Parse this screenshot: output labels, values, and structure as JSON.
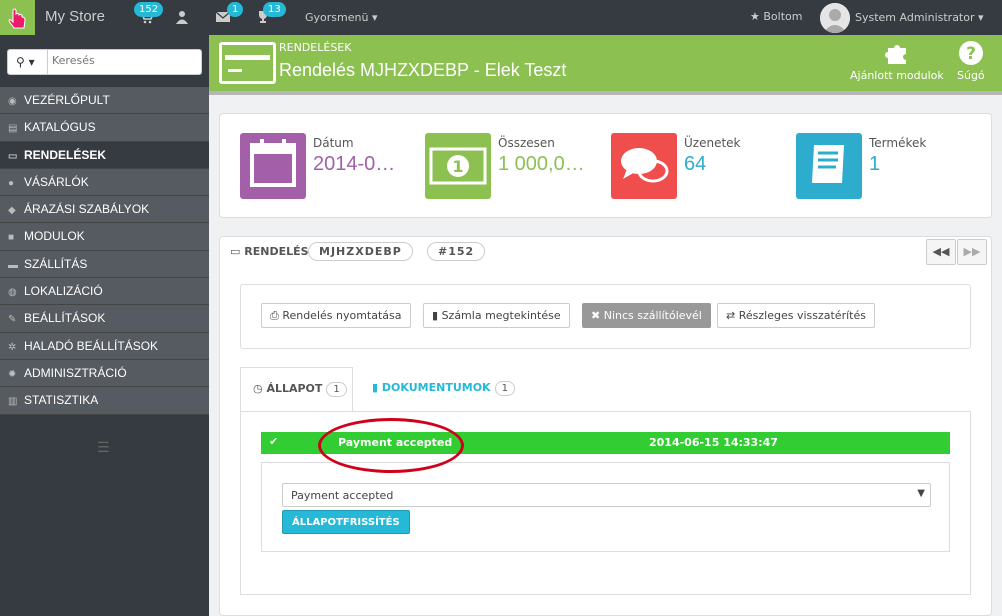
{
  "topbar": {
    "store_name": "My Store",
    "cart_badge": "152",
    "messages_badge": "1",
    "trophy_badge": "13",
    "quick_access": "Gyorsmenü",
    "my_shop": "Boltom",
    "user_name": "System Administrator"
  },
  "sidebar": {
    "search_placeholder": "Keresés",
    "items": [
      {
        "label": "VEZÉRLŐPULT"
      },
      {
        "label": "KATALÓGUS"
      },
      {
        "label": "RENDELÉSEK"
      },
      {
        "label": "VÁSÁRLÓK"
      },
      {
        "label": "ÁRAZÁSI SZABÁLYOK"
      },
      {
        "label": "MODULOK"
      },
      {
        "label": "SZÁLLÍTÁS"
      },
      {
        "label": "LOKALIZÁCIÓ"
      },
      {
        "label": "BEÁLLÍTÁSOK"
      },
      {
        "label": "HALADÓ BEÁLLÍTÁSOK"
      },
      {
        "label": "ADMINISZTRÁCIÓ"
      },
      {
        "label": "STATISZTIKA"
      }
    ]
  },
  "header": {
    "breadcrumb": "RENDELÉSEK",
    "title": "Rendelés MJHZXDEBP - Elek Teszt",
    "recommended_modules": "Ajánlott modulok",
    "help": "Súgó"
  },
  "kpis": [
    {
      "label": "Dátum",
      "value": "2014-0…",
      "color": "#a35fa8"
    },
    {
      "label": "Összesen",
      "value": "1 000,0…",
      "color": "#8cc152"
    },
    {
      "label": "Üzenetek",
      "value": "64",
      "color": "#f04d4d"
    },
    {
      "label": "Termékek",
      "value": "1",
      "color": "#2eacce"
    }
  ],
  "order": {
    "heading": "RENDELÉS",
    "reference": "MJHZXDEBP",
    "id": "#152",
    "actions": {
      "print": "Rendelés nyomtatása",
      "invoice": "Számla megtekintése",
      "no_delivery": "Nincs szállítólevél",
      "partial_refund": "Részleges visszatérítés"
    },
    "tabs": {
      "status_label": "ÁLLAPOT",
      "status_count": "1",
      "documents_label": "DOKUMENTUMOK",
      "documents_count": "1"
    },
    "status_history": {
      "status": "Payment accepted",
      "date": "2014-06-15 14:33:47",
      "color": "#32cd32"
    },
    "status_select_value": "Payment accepted",
    "update_button": "ÁLLAPOTFRISSÍTÉS"
  }
}
